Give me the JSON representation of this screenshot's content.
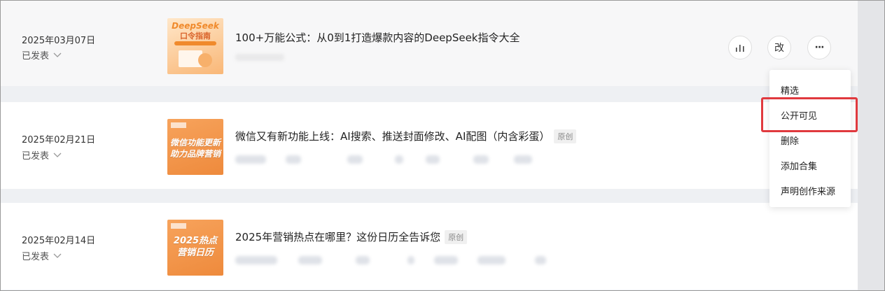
{
  "articles": [
    {
      "date": "2025年03月07日",
      "status": "已发表",
      "title": "100+万能公式：从0到1打造爆款内容的DeepSeek指令大全",
      "original_tag": "",
      "cover_text": [
        "DeepSeek",
        "口令指南"
      ]
    },
    {
      "date": "2025年02月21日",
      "status": "已发表",
      "title": "微信又有新功能上线：AI搜索、推送封面修改、AI配图（内含彩蛋）",
      "original_tag": "原创",
      "cover_text": [
        "微信功能更新",
        "助力品牌营销"
      ]
    },
    {
      "date": "2025年02月14日",
      "status": "已发表",
      "title": "2025年营销热点在哪里？这份日历全告诉您",
      "original_tag": "原创",
      "cover_text": [
        "2025热点",
        "营销日历"
      ]
    }
  ],
  "actions": {
    "edit_label": "改",
    "more_label": "···",
    "stats_icon": "bar-chart-icon"
  },
  "menu": {
    "items": [
      "精选",
      "公开可见",
      "删除",
      "添加合集",
      "声明创作来源"
    ],
    "highlighted": "公开可见"
  },
  "colors": {
    "highlight_border": "#e0393e",
    "cover_orange": "#ee8a3c"
  }
}
